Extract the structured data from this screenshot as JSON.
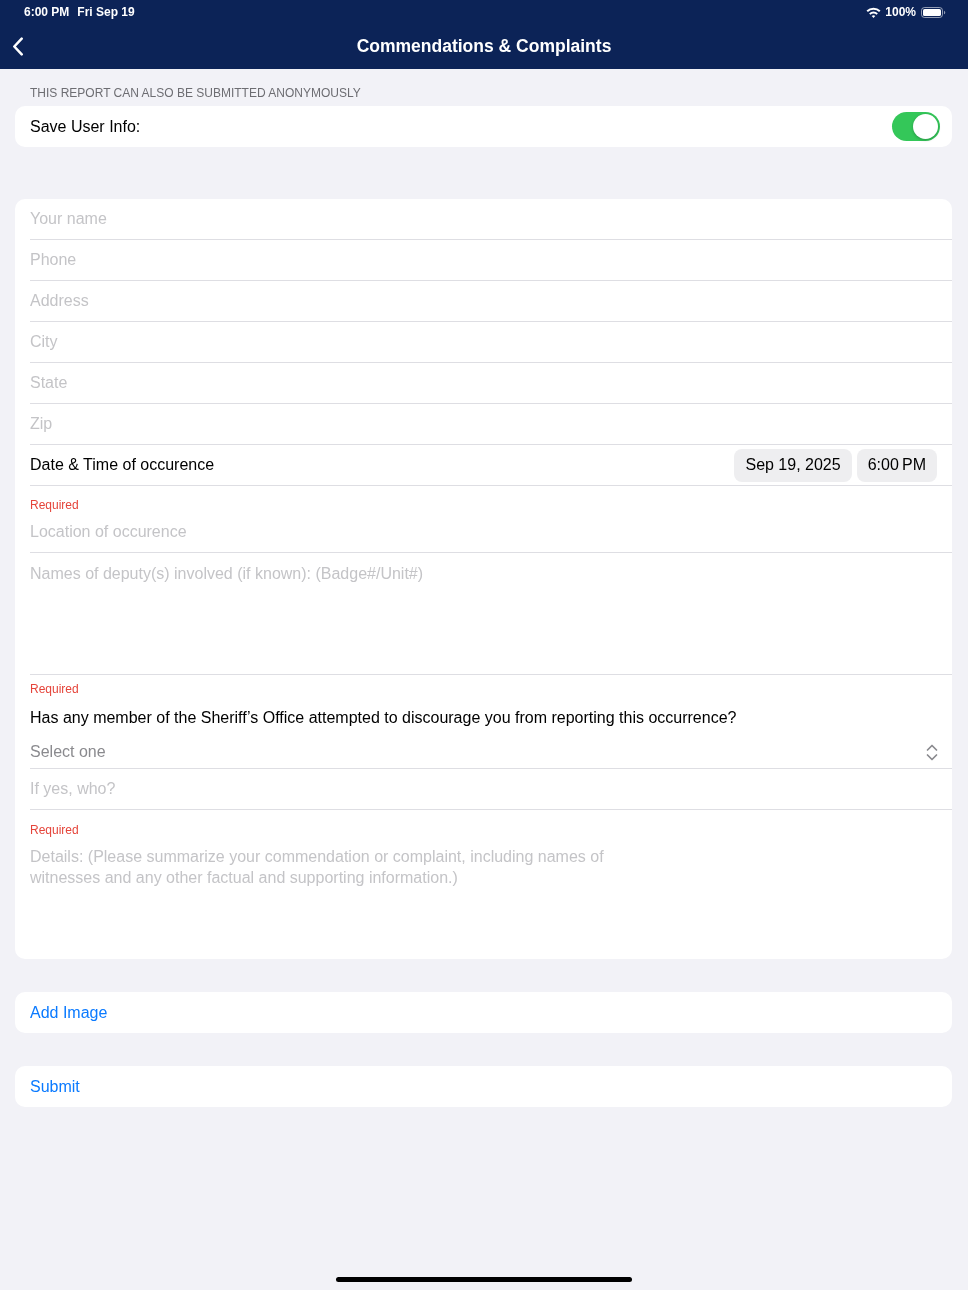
{
  "status_bar": {
    "time": "6:00 PM",
    "date": "Fri Sep 19",
    "battery": "100%"
  },
  "nav_bar": {
    "title": "Commendations & Complaints"
  },
  "anonymous_section": {
    "header": "THIS REPORT CAN ALSO BE SUBMITTED ANONYMOUSLY",
    "save_user_info": {
      "label": "Save User Info:",
      "on": true
    }
  },
  "form": {
    "fields": [
      {
        "kind": "text",
        "placeholder": "Your name"
      },
      {
        "kind": "text",
        "placeholder": "Phone"
      },
      {
        "kind": "text",
        "placeholder": "Address"
      },
      {
        "kind": "text",
        "placeholder": "City"
      },
      {
        "kind": "text",
        "placeholder": "State"
      },
      {
        "kind": "text",
        "placeholder": "Zip"
      },
      {
        "kind": "datetime",
        "label": "Date & Time of occurence",
        "date": "Sep 19, 2025",
        "time": "6:00 PM"
      },
      {
        "kind": "text",
        "note": "Required",
        "placeholder": "Location of occurence"
      },
      {
        "kind": "textarea",
        "placeholder": "Names of deputy(s) involved (if known): (Badge#/Unit#)"
      },
      {
        "kind": "select",
        "note": "Required",
        "question": "Has any member of the Sheriff’s Office attempted to discourage you from reporting this occurrence?",
        "placeholder": "Select one"
      },
      {
        "kind": "text",
        "placeholder": "If yes, who?"
      },
      {
        "kind": "textarea",
        "note": "Required",
        "placeholder": "Details: (Please summarize your commendation or complaint, including names of witnesses and any other factual and supporting information.)"
      }
    ]
  },
  "actions": [
    {
      "label": "Add Image"
    },
    {
      "label": "Submit"
    }
  ]
}
